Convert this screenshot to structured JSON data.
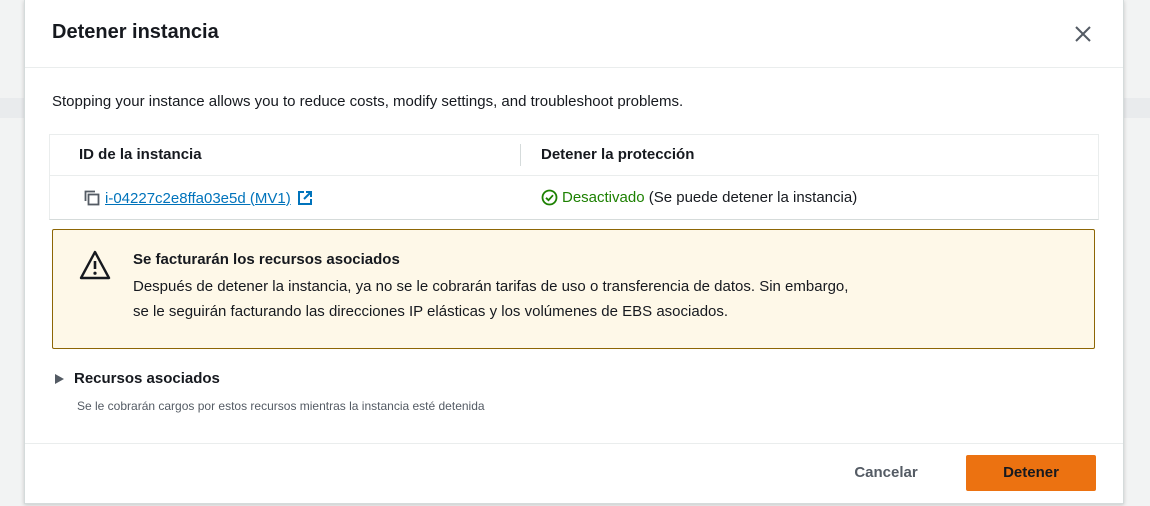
{
  "modal": {
    "title": "Detener instancia",
    "intro": "Stopping your instance allows you to reduce costs, modify settings, and troubleshoot problems."
  },
  "table": {
    "headers": [
      "ID de la instancia",
      "Detener la protección"
    ],
    "row": {
      "instance_id": "i-04227c2e8ffa03e5d (MV1)",
      "protection_status": "Desactivado",
      "protection_note": " (Se puede detener la instancia)"
    }
  },
  "alert": {
    "title": "Se facturarán los recursos asociados",
    "body_line1": "Después de detener la instancia, ya no se le cobrarán tarifas de uso o transferencia de datos. Sin embargo,",
    "body_line2": "se le seguirán facturando las direcciones IP elásticas y los volúmenes de EBS asociados."
  },
  "expander": {
    "label": "Recursos asociados",
    "description": "Se le cobrarán cargos por estos recursos mientras la instancia esté detenida"
  },
  "footer": {
    "cancel_label": "Cancelar",
    "confirm_label": "Detener"
  },
  "icons": {
    "close": "close-icon",
    "copy": "copy-icon",
    "external": "external-link-icon",
    "status": "check-circle-icon",
    "warning": "warning-icon",
    "caret": "caret-right-icon"
  },
  "colors": {
    "link": "#0073bb",
    "success": "#1d8102",
    "warning_bg": "#fef8e8",
    "warning_border": "#8d6605",
    "primary_button": "#ec7211"
  }
}
